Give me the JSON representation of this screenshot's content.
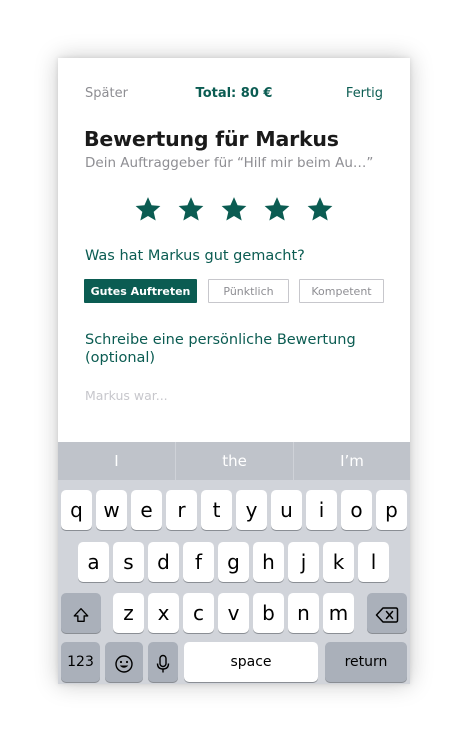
{
  "header": {
    "later_label": "Später",
    "total_label": "Total: 80 €",
    "done_label": "Fertig"
  },
  "title": "Bewertung für Markus",
  "subtitle": "Dein Auftraggeber für “Hilf mir beim Au…”",
  "rating": {
    "value": 5,
    "max": 5,
    "color": "#0b5c52"
  },
  "question": "Was hat Markus gut gemacht?",
  "chips": [
    {
      "label": "Gutes Auftreten",
      "selected": true
    },
    {
      "label": "Pünktlich",
      "selected": false
    },
    {
      "label": "Kompetent",
      "selected": false
    }
  ],
  "review": {
    "label": "Schreibe eine persönliche Bewertung (optional)",
    "placeholder": "Markus war...",
    "value": ""
  },
  "keyboard": {
    "suggestions": [
      "I",
      "the",
      "I’m"
    ],
    "row1": [
      "q",
      "w",
      "e",
      "r",
      "t",
      "y",
      "u",
      "i",
      "o",
      "p"
    ],
    "row2": [
      "a",
      "s",
      "d",
      "f",
      "g",
      "h",
      "j",
      "k",
      "l"
    ],
    "row3": [
      "z",
      "x",
      "c",
      "v",
      "b",
      "n",
      "m"
    ],
    "numbers_label": "123",
    "space_label": "space",
    "return_label": "return"
  },
  "colors": {
    "accent": "#0b5c52",
    "muted": "#8e8e93",
    "chip_border": "#c7c7cc"
  }
}
